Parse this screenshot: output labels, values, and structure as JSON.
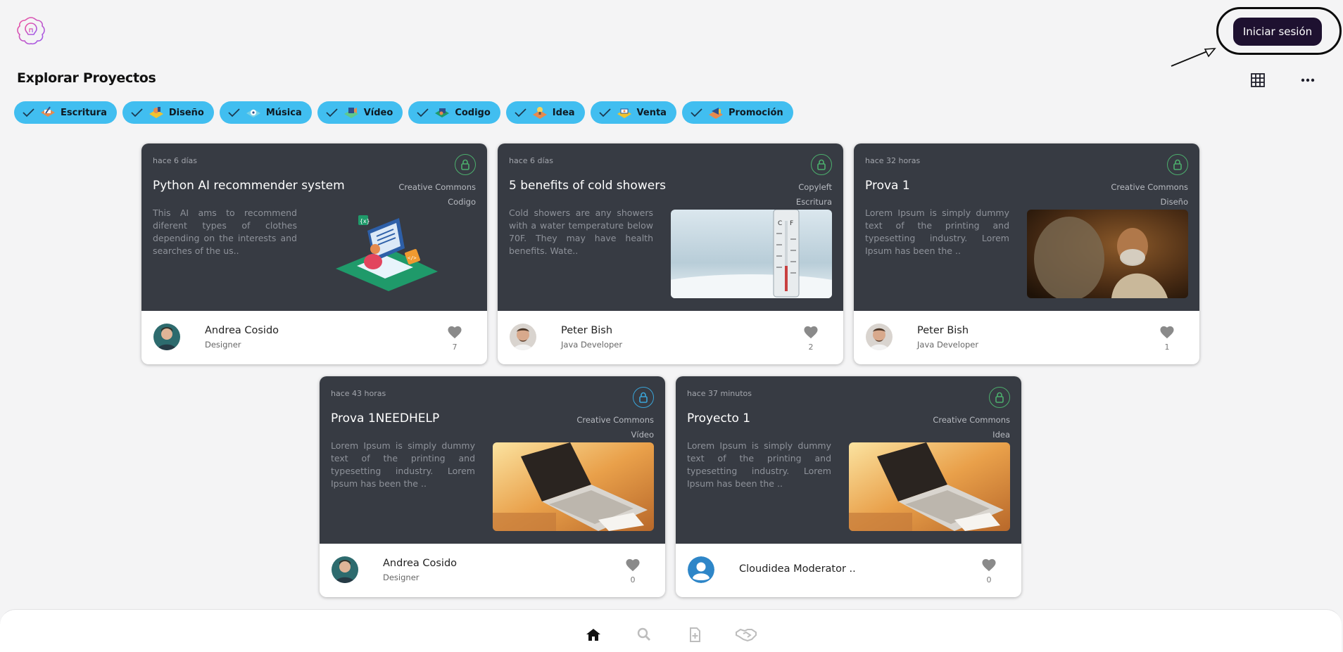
{
  "header": {
    "login_label": "Iniciar sesión"
  },
  "page": {
    "title": "Explorar Proyectos"
  },
  "categories": [
    {
      "label": "Escritura",
      "icon": "writing-icon"
    },
    {
      "label": "Diseño",
      "icon": "design-icon"
    },
    {
      "label": "Música",
      "icon": "music-icon"
    },
    {
      "label": "Vídeo",
      "icon": "video-icon"
    },
    {
      "label": "Codigo",
      "icon": "code-icon"
    },
    {
      "label": "Idea",
      "icon": "idea-icon"
    },
    {
      "label": "Venta",
      "icon": "sale-icon"
    },
    {
      "label": "Promoción",
      "icon": "promotion-icon"
    }
  ],
  "projects": [
    {
      "time": "hace 6 días",
      "title": "Python AI recommender system",
      "license": "Creative Commons",
      "category": "Codigo",
      "description": "This AI ams to recommend diferent types of clothes depending on the interests and searches of the us..",
      "author": "Andrea Cosido",
      "role": "Designer",
      "likes": "7",
      "lock_color": "#4caf6d"
    },
    {
      "time": "hace 6 días",
      "title": "5 benefits of cold showers",
      "license": "Copyleft",
      "category": "Escritura",
      "description": "Cold showers are any showers with a water temperature below 70F. They may have health benefits. Wate..",
      "author": "Peter Bish",
      "role": "Java Developer",
      "likes": "2",
      "lock_color": "#4caf6d"
    },
    {
      "time": "hace 32 horas",
      "title": "Prova 1",
      "license": "Creative Commons",
      "category": "Diseño",
      "description": "Lorem Ipsum is simply dummy text of the printing and typesetting industry. Lorem Ipsum has been the ..",
      "author": "Peter Bish",
      "role": "Java Developer",
      "likes": "1",
      "lock_color": "#4caf6d"
    },
    {
      "time": "hace 43 horas",
      "title": "Prova 1NEEDHELP",
      "license": "Creative Commons",
      "category": "Vídeo",
      "description": "Lorem Ipsum is simply dummy text of the printing and typesetting industry. Lorem Ipsum has been the ..",
      "author": "Andrea Cosido",
      "role": "Designer",
      "likes": "0",
      "lock_color": "#3aa4d8"
    },
    {
      "time": "hace 37 minutos",
      "title": "Proyecto 1",
      "license": "Creative Commons",
      "category": "Idea",
      "description": "Lorem Ipsum is simply dummy text of the printing and typesetting industry. Lorem Ipsum has been the ..",
      "author": "Cloudidea Moderator ..",
      "role": "",
      "likes": "0",
      "lock_color": "#4caf6d"
    }
  ],
  "nav": [
    {
      "name": "home-icon"
    },
    {
      "name": "search-icon"
    },
    {
      "name": "new-project-icon"
    },
    {
      "name": "handshake-icon"
    }
  ]
}
